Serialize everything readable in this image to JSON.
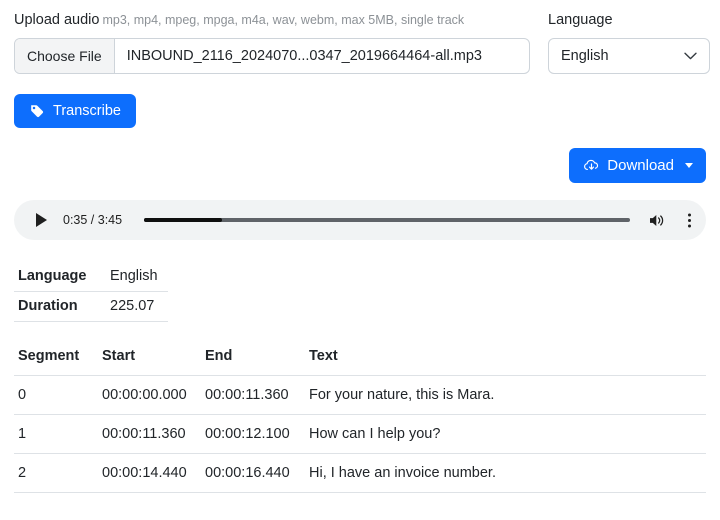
{
  "upload": {
    "label": "Upload audio",
    "hint": "mp3, mp4, mpeg, mpga, m4a, wav, webm, max 5MB, single track",
    "choose_file_label": "Choose File",
    "file_name": "INBOUND_2116_2024070...0347_2019664464-all.mp3"
  },
  "language_field": {
    "label": "Language",
    "selected": "English",
    "caret_icon": "chevron-down-icon"
  },
  "actions": {
    "transcribe_label": "Transcribe",
    "transcribe_icon": "tag-icon",
    "download_label": "Download",
    "download_icon": "cloud-download-icon",
    "download_caret_icon": "caret-down-icon",
    "primary_color": "#0d6efd"
  },
  "player": {
    "play_icon": "play-icon",
    "time_label": "0:35 / 3:45",
    "current_time": "0:35",
    "total_time": "3:45",
    "progress_percent": 16,
    "volume_icon": "volume-icon",
    "more_icon": "more-vertical-icon",
    "background_color": "#f1f3f4"
  },
  "meta": {
    "rows": [
      {
        "key": "Language",
        "value": "English"
      },
      {
        "key": "Duration",
        "value": "225.07"
      }
    ]
  },
  "segments": {
    "headers": [
      "Segment",
      "Start",
      "End",
      "Text"
    ],
    "rows": [
      {
        "segment": "0",
        "start": "00:00:00.000",
        "end": "00:00:11.360",
        "text": "For your nature, this is Mara."
      },
      {
        "segment": "1",
        "start": "00:00:11.360",
        "end": "00:00:12.100",
        "text": "How can I help you?"
      },
      {
        "segment": "2",
        "start": "00:00:14.440",
        "end": "00:00:16.440",
        "text": "Hi, I have an invoice number."
      }
    ]
  }
}
